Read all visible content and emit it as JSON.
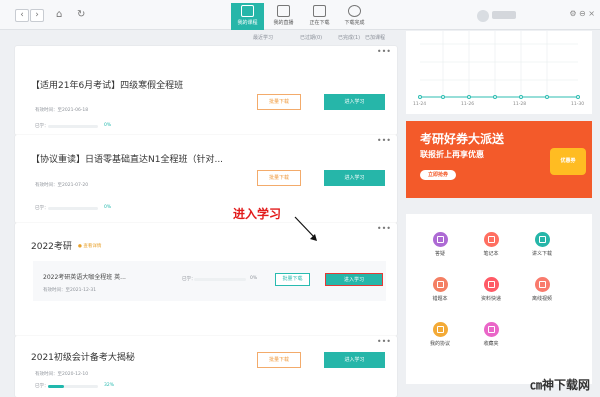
{
  "topbar": {
    "tabs": [
      {
        "label": "我的课程"
      },
      {
        "label": "我的直播"
      },
      {
        "label": "正在下载"
      },
      {
        "label": "下载完成"
      }
    ],
    "right_icons": [
      "⚙",
      "⊖",
      "×"
    ]
  },
  "content": {
    "subtabs": [
      "最近学习",
      "已过期(0)",
      "已完成(1)",
      "已加课程"
    ],
    "cards": [
      {
        "title": "【适用21年6月考试】四级寒假全程班",
        "meta": "有效时间：至2021-06-18",
        "progress_label": "已学：",
        "progress_value": "0%",
        "progress_fraction": 0,
        "button_outline": "批量下载",
        "button_solid": "进入学习"
      },
      {
        "title": "【协议重读】日语零基础直达N1全程班（针对...",
        "meta": "有效时间：至2021-07-20",
        "progress_label": "已学：",
        "progress_value": "0%",
        "progress_fraction": 0,
        "button_outline": "批量下载",
        "button_solid": "进入学习"
      },
      {
        "title": "2022考研",
        "badge": "查看详情",
        "subtitle": "2022考研英语大咖全程班 英...",
        "meta": "有效时间：至2021-12-31",
        "progress_label": "已学：",
        "progress_value": "0%",
        "progress_fraction": 0,
        "button_outline": "批量下载",
        "button_solid": "进入学习"
      },
      {
        "title": "2021初级会计备考大揭秘",
        "meta": "有效时间：至2020-12-10",
        "progress_label": "已学：",
        "progress_value": "32%",
        "progress_fraction": 0.32,
        "button_outline": "批量下载",
        "button_solid": "进入学习"
      }
    ]
  },
  "sidebar": {
    "chart_dates": [
      "11-24",
      "11-26",
      "11-28",
      "11-30"
    ],
    "promo": {
      "heading": "考研好券大派送",
      "subheading": "联报折上再享优惠",
      "button": "立即抢券",
      "badge": "优惠券"
    },
    "features": [
      {
        "label": "答疑",
        "color": "#ad6ad4"
      },
      {
        "label": "笔记本",
        "color": "#ff6f61"
      },
      {
        "label": "讲义下载",
        "color": "#26b6a9"
      },
      {
        "label": "错题本",
        "color": "#f47f63"
      },
      {
        "label": "资料快递",
        "color": "#ff5a66"
      },
      {
        "label": "离线视频",
        "color": "#f97b6d"
      },
      {
        "label": "我的协议",
        "color": "#f3aa37"
      },
      {
        "label": "收藏夹",
        "color": "#ea66c8"
      }
    ]
  },
  "annotation": "进入学习",
  "watermark": "㎝神下载网"
}
